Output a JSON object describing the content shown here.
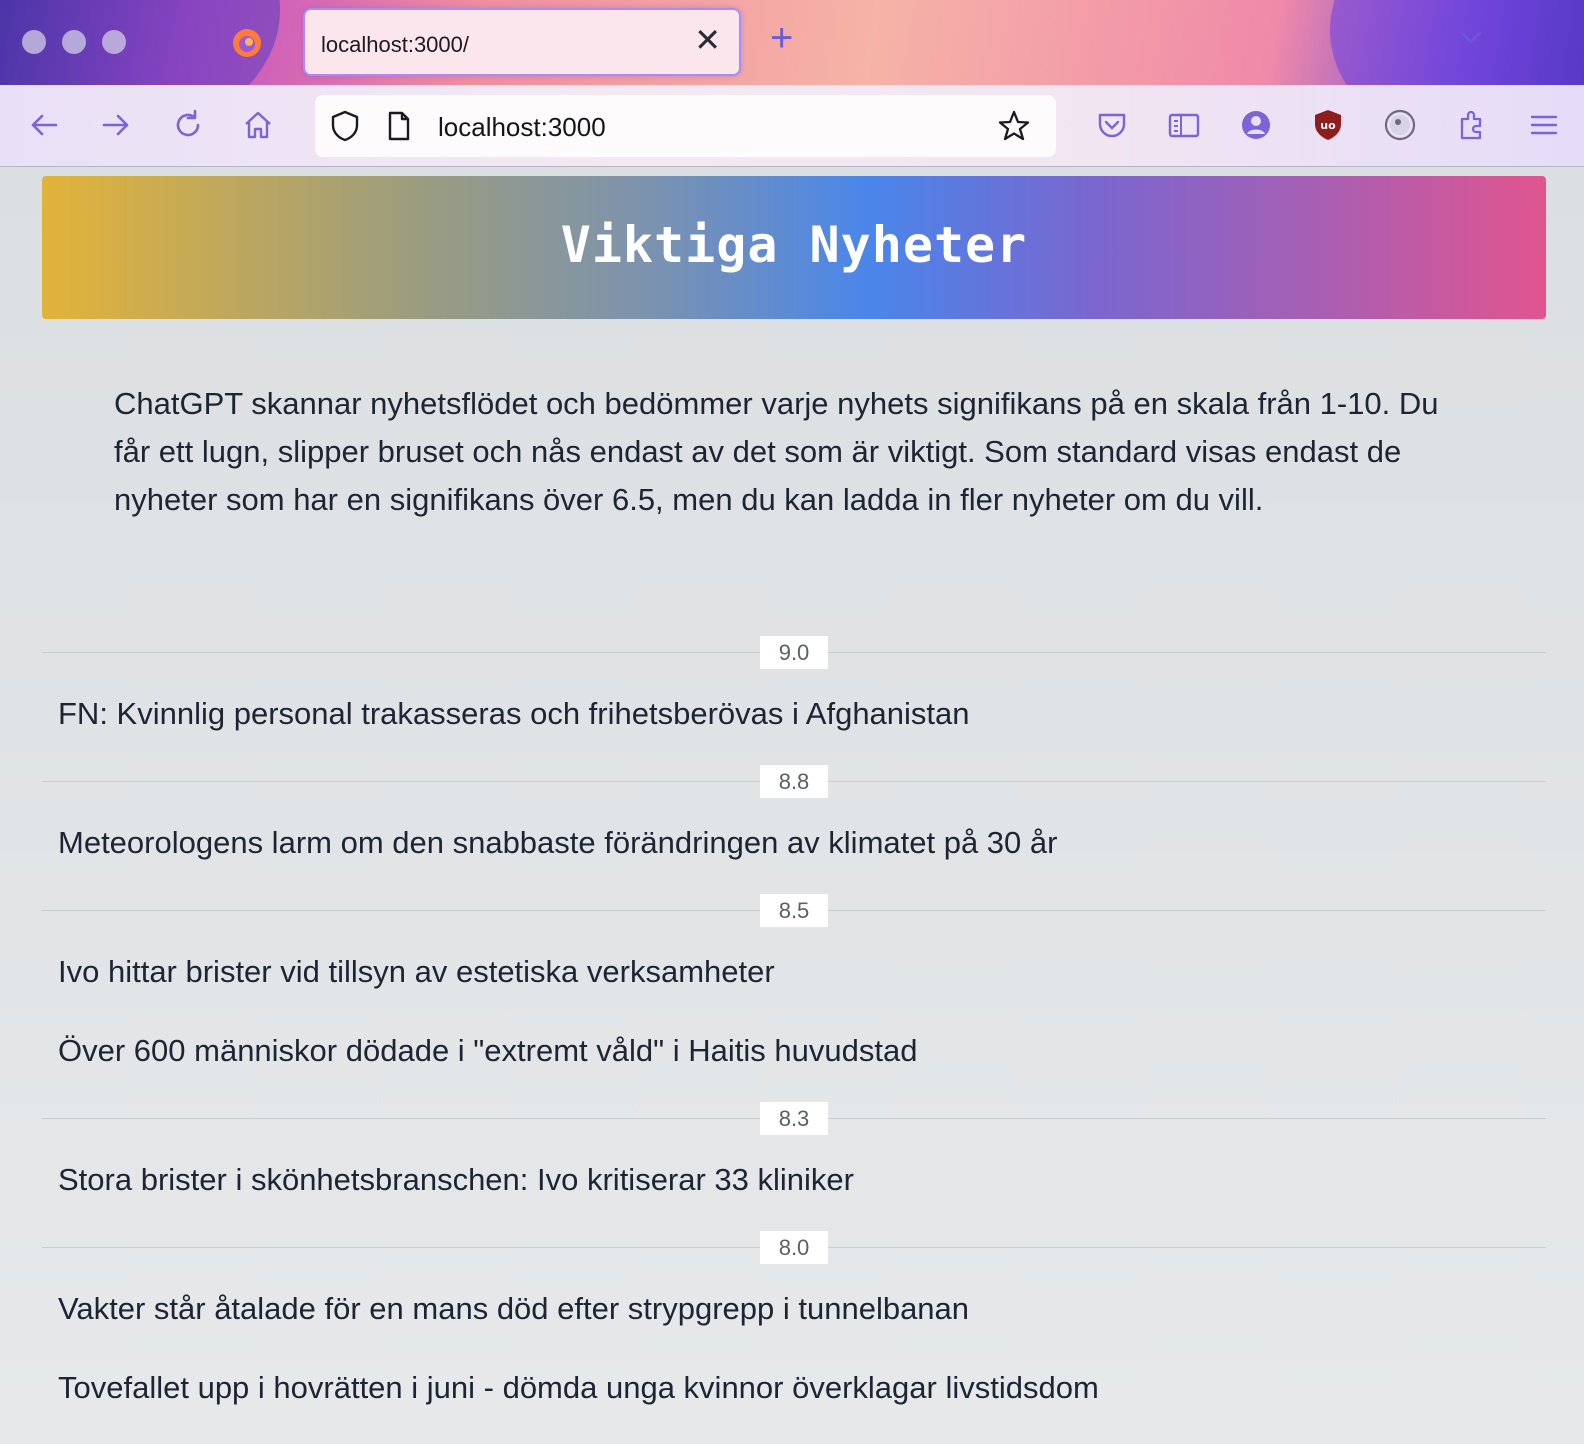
{
  "browser": {
    "tab_title": "localhost:3000/",
    "url": "localhost:3000"
  },
  "page": {
    "title": "Viktiga Nyheter",
    "intro": "ChatGPT skannar nyhetsflödet och bedömmer varje nyhets signifikans på en skala från 1-10. Du får ett lugn, slipper bruset och nås endast av det som är viktigt. Som standard visas endast de nyheter som har en signifikans över 6.5, men du kan ladda in fler nyheter om du vill.",
    "groups": [
      {
        "score": "9.0",
        "items": [
          "FN: Kvinnlig personal trakasseras och frihetsberövas i Afghanistan"
        ]
      },
      {
        "score": "8.8",
        "items": [
          "Meteorologens larm om den snabbaste förändringen av klimatet på 30 år"
        ]
      },
      {
        "score": "8.5",
        "items": [
          "Ivo hittar brister vid tillsyn av estetiska verksamheter",
          "Över 600 människor dödade i \"extremt våld\" i Haitis huvudstad"
        ]
      },
      {
        "score": "8.3",
        "items": [
          "Stora brister i skönhetsbranschen: Ivo kritiserar 33 kliniker"
        ]
      },
      {
        "score": "8.0",
        "items": [
          "Vakter står åtalade för en mans död efter strypgrepp i tunnelbanan",
          "Tovefallet upp i hovrätten i juni - dömda unga kvinnor överklagar livstidsdom"
        ]
      }
    ]
  }
}
